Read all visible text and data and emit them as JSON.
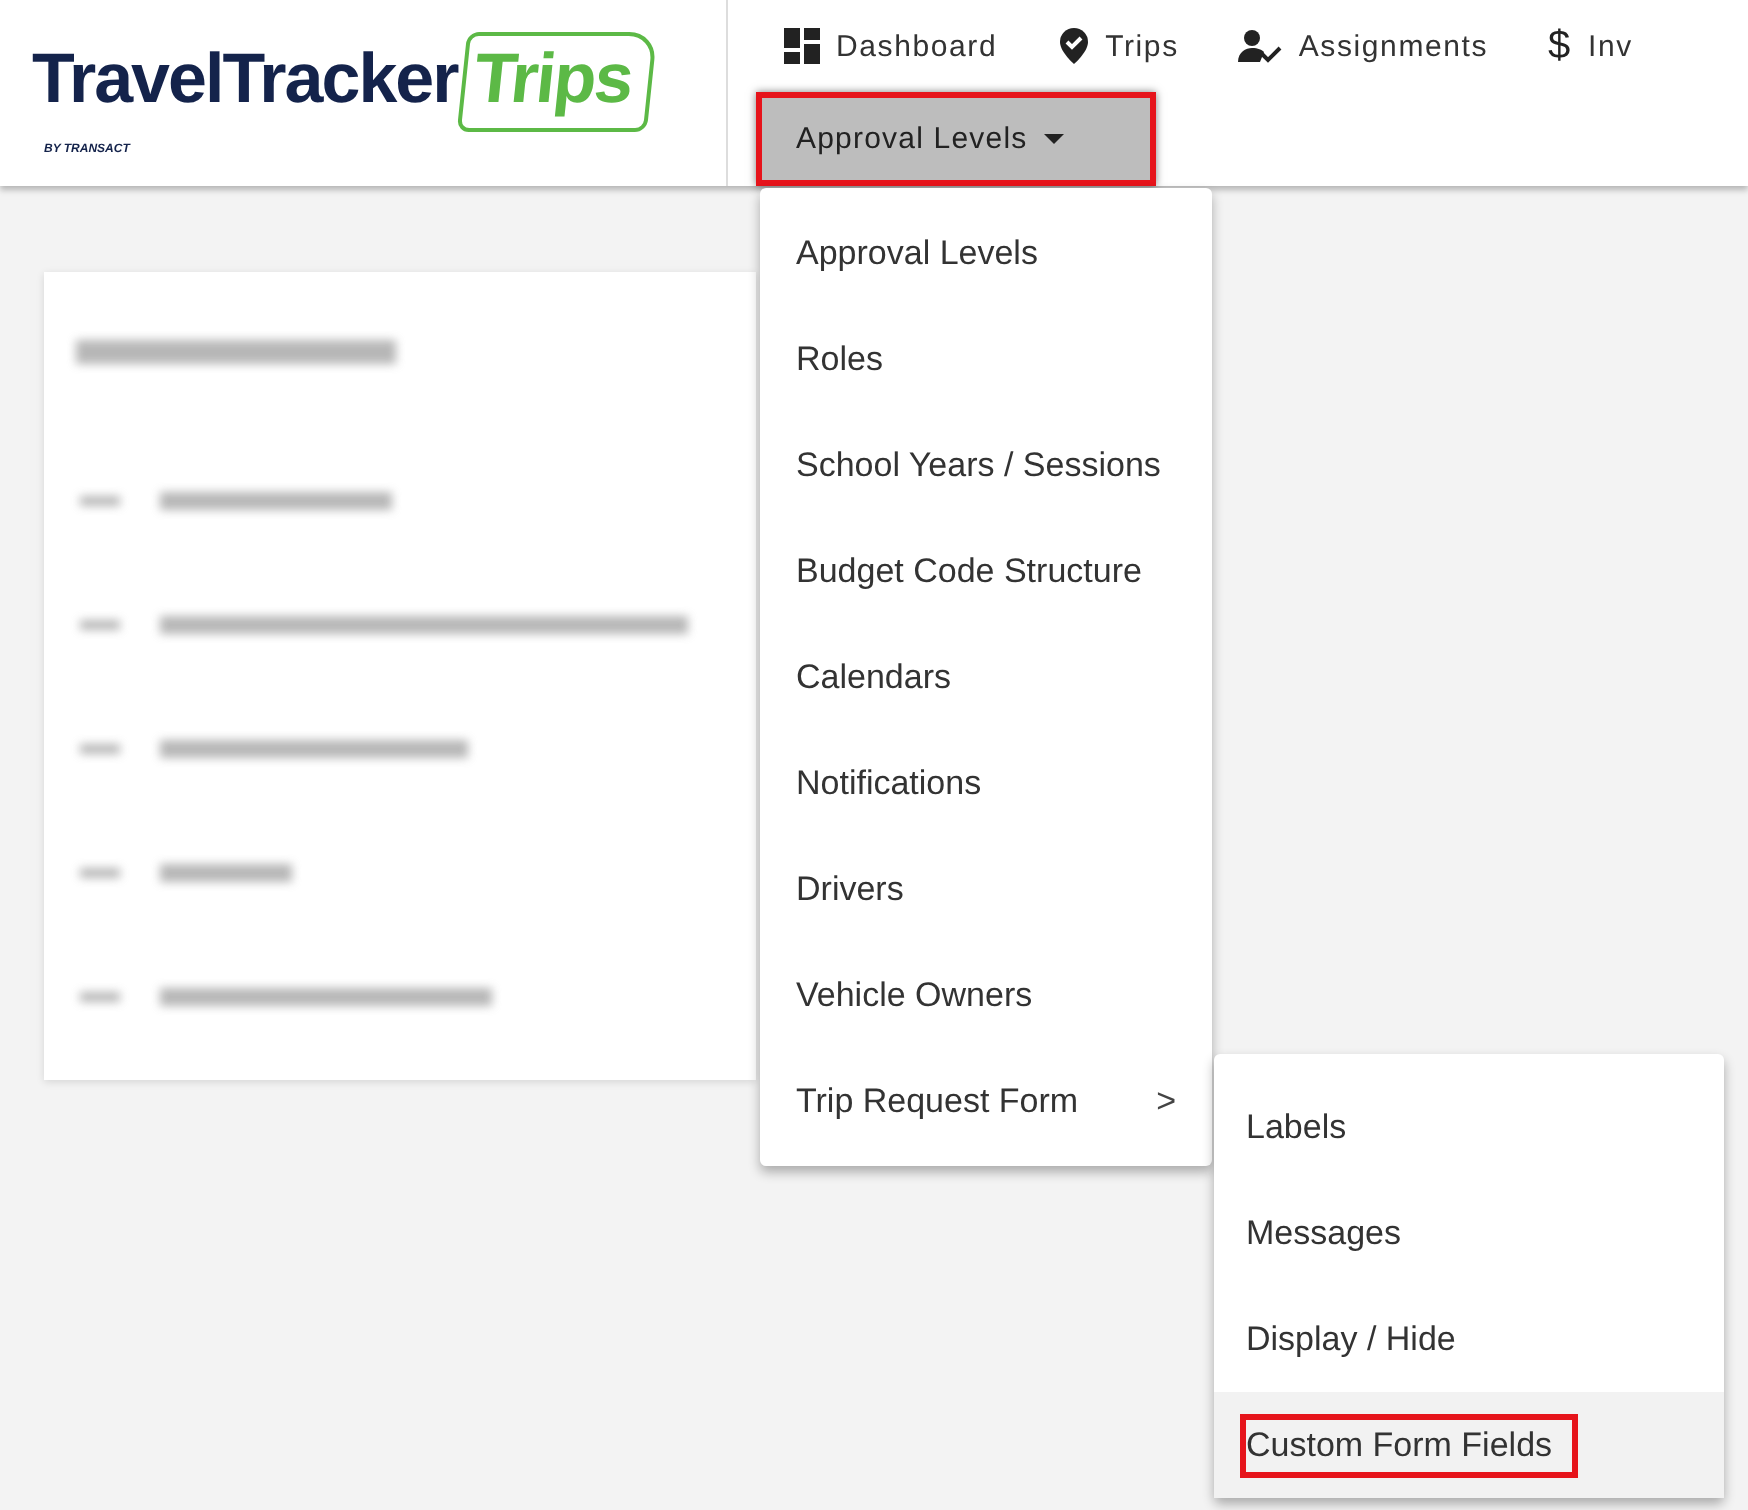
{
  "logo": {
    "name": "TravelTracker",
    "accent": "Trips",
    "byline": "BY TRANSACT"
  },
  "nav": [
    {
      "kind": "dashboard",
      "label": "Dashboard"
    },
    {
      "kind": "trips",
      "label": "Trips"
    },
    {
      "kind": "assignments",
      "label": "Assignments"
    },
    {
      "label": "Inv",
      "icon": "$"
    }
  ],
  "submenu_button": {
    "label": "Approval Levels",
    "highlighted": true
  },
  "menu": [
    {
      "label": "Approval Levels"
    },
    {
      "label": "Roles"
    },
    {
      "label": "School Years / Sessions"
    },
    {
      "label": "Budget Code Structure"
    },
    {
      "label": "Calendars"
    },
    {
      "label": "Notifications"
    },
    {
      "label": "Drivers"
    },
    {
      "label": "Vehicle Owners"
    },
    {
      "label": "Trip Request Form",
      "caret": ">"
    }
  ],
  "submenu": [
    {
      "label": "Labels",
      "selected": false,
      "highlighted": false
    },
    {
      "label": "Messages",
      "selected": false,
      "highlighted": false
    },
    {
      "label": "Display / Hide",
      "selected": false,
      "highlighted": false
    },
    {
      "label": "Custom Form Fields",
      "selected": true,
      "highlighted": true
    }
  ]
}
